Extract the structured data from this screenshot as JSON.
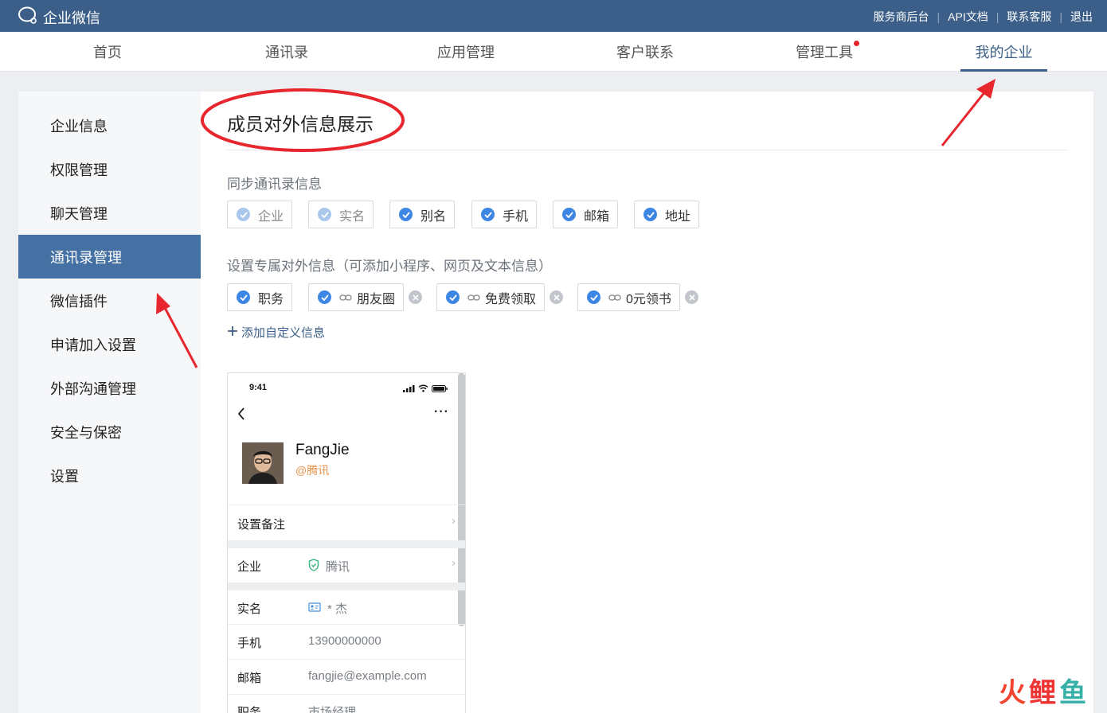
{
  "app": {
    "name": "企业微信",
    "logo_icon": "wecom-logo-icon"
  },
  "topbar": {
    "links": [
      "服务商后台",
      "API文档",
      "联系客服",
      "退出"
    ]
  },
  "mainnav": {
    "tabs": [
      {
        "label": "首页"
      },
      {
        "label": "通讯录"
      },
      {
        "label": "应用管理"
      },
      {
        "label": "客户联系"
      },
      {
        "label": "管理工具",
        "badge": "red-dot"
      },
      {
        "label": "我的企业",
        "active": true
      }
    ]
  },
  "sidebar": {
    "items": [
      {
        "label": "企业信息"
      },
      {
        "label": "权限管理"
      },
      {
        "label": "聊天管理"
      },
      {
        "label": "通讯录管理",
        "active": true
      },
      {
        "label": "微信插件"
      },
      {
        "label": "申请加入设置"
      },
      {
        "label": "外部沟通管理"
      },
      {
        "label": "安全与保密"
      },
      {
        "label": "设置"
      }
    ]
  },
  "content": {
    "title": "成员对外信息展示",
    "sync_label": "同步通讯录信息",
    "sync_chips": [
      {
        "label": "企业",
        "checked": true,
        "locked": true
      },
      {
        "label": "实名",
        "checked": true,
        "locked": true
      },
      {
        "label": "别名",
        "checked": true
      },
      {
        "label": "手机",
        "checked": true
      },
      {
        "label": "邮箱",
        "checked": true
      },
      {
        "label": "地址",
        "checked": true
      }
    ],
    "custom_label": "设置专属对外信息（可添加小程序、网页及文本信息）",
    "custom_chips": [
      {
        "label": "职务",
        "checked": true,
        "link": false,
        "removable": false
      },
      {
        "label": "朋友圈",
        "checked": true,
        "link": true,
        "removable": true
      },
      {
        "label": "免费领取",
        "checked": true,
        "link": true,
        "removable": true
      },
      {
        "label": "0元领书",
        "checked": true,
        "link": true,
        "removable": true
      }
    ],
    "add_custom": "添加自定义信息"
  },
  "phone": {
    "time": "9:41",
    "more": "···",
    "name": "FangJie",
    "org": "@腾讯",
    "set_remark": "设置备注",
    "rows": [
      {
        "label": "企业",
        "value": "腾讯",
        "icon": "verified-shield-icon"
      },
      {
        "label": "实名",
        "value": "* 杰",
        "icon": "id-card-icon"
      },
      {
        "label": "手机",
        "value": "13900000000"
      },
      {
        "label": "邮箱",
        "value": "fangjie@example.com"
      },
      {
        "label": "职务",
        "value": "市场经理"
      }
    ]
  },
  "watermark": {
    "chars": [
      "火",
      "鲤",
      "鱼"
    ]
  },
  "colors": {
    "topbar": "#3b5f88",
    "accent": "#3b5f88",
    "sidebar_active": "#4470a3",
    "check": "#3d86e4",
    "annotation": "#e8262e",
    "org_orange": "#e6934b"
  }
}
